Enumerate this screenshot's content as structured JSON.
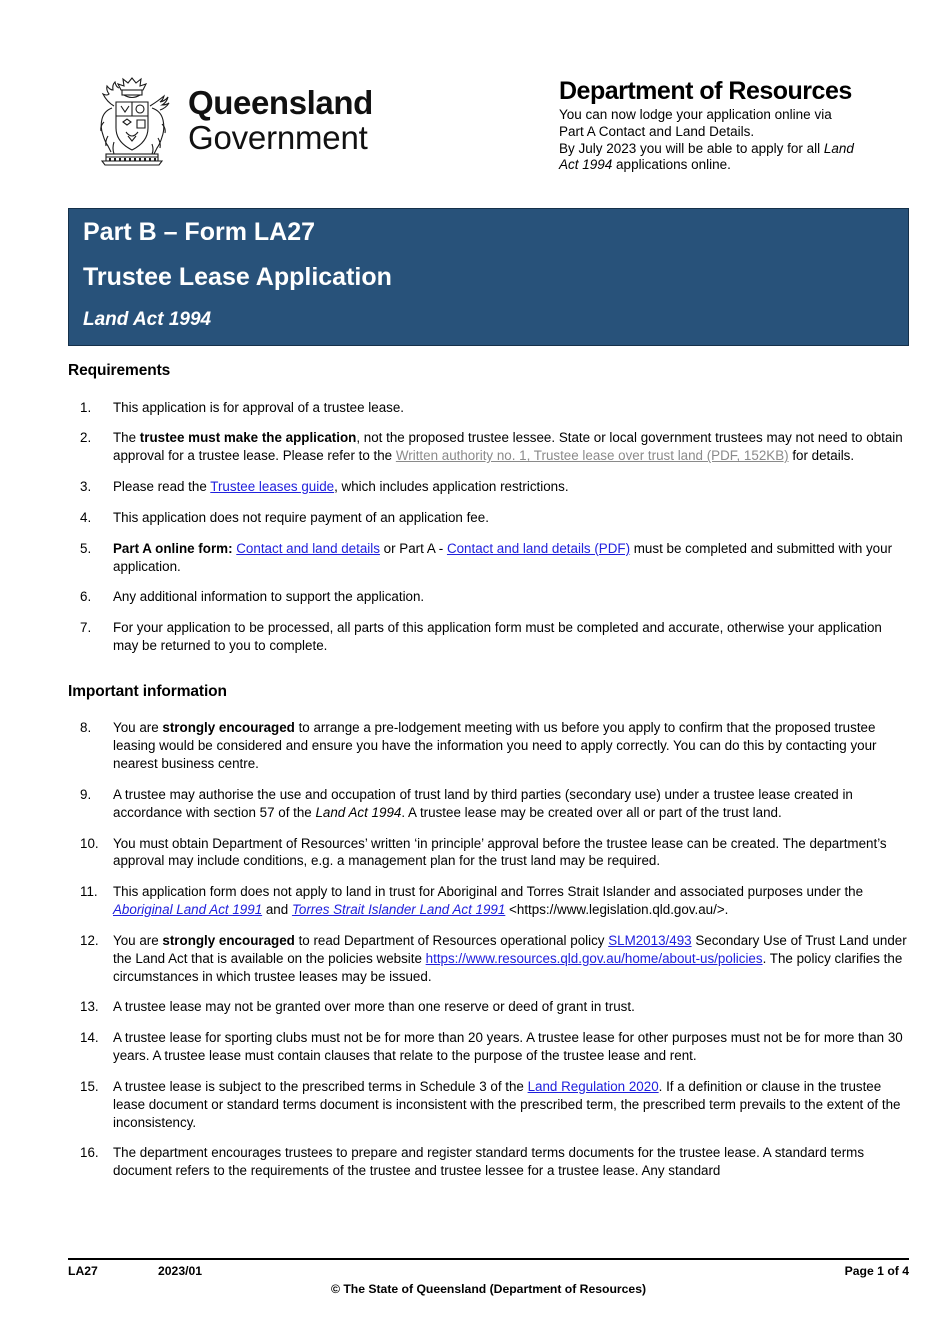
{
  "header": {
    "crest_icon": "queensland-coat-of-arms-icon",
    "wordmark_line1": "Queensland",
    "wordmark_line2": "Government",
    "department_title": "Department of Resources",
    "department_note_line1": "You can now lodge your application online via",
    "department_note_line2": "Part A Contact and Land Details.",
    "department_note_line3_pre": "By July 2023 you will be able to apply for all ",
    "department_note_line3_em": "Land",
    "department_note_line4_em": "Act 1994",
    "department_note_line4_post": " applications online."
  },
  "banner": {
    "line1": "Part B – Form LA27",
    "line2": "Trustee Lease Application",
    "line3": "Land Act 1994",
    "background_color": "#28527a",
    "text_color": "#ffffff"
  },
  "sections": {
    "requirements_heading": "Requirements",
    "important_heading": "Important information"
  },
  "requirements": [
    {
      "num": "1.",
      "parts": [
        {
          "t": "This application is for approval of a trustee lease."
        }
      ]
    },
    {
      "num": "2.",
      "parts": [
        {
          "t": "The "
        },
        {
          "t": "trustee must make the application",
          "b": true
        },
        {
          "t": ", not the proposed trustee lessee. State or local government trustees may not need to obtain approval for a trustee lease. Please refer to the "
        },
        {
          "t": "Written authority no. 1, Trustee lease over trust land (PDF, 152KB)",
          "link": "grey"
        },
        {
          "t": "  for details."
        }
      ]
    },
    {
      "num": "3.",
      "parts": [
        {
          "t": "Please read the "
        },
        {
          "t": "Trustee leases guide",
          "link": "blue"
        },
        {
          "t": ", which includes application restrictions."
        }
      ]
    },
    {
      "num": "4.",
      "parts": [
        {
          "t": "This application does not require payment of an application fee."
        }
      ]
    },
    {
      "num": "5.",
      "parts": [
        {
          "t": "Part A online form:",
          "b": true
        },
        {
          "t": " "
        },
        {
          "t": "Contact and land details",
          "link": "blue"
        },
        {
          "t": " or Part A - "
        },
        {
          "t": "Contact and land details (PDF)",
          "link": "blue"
        },
        {
          "t": " must be completed and submitted with your application."
        }
      ]
    },
    {
      "num": "6.",
      "parts": [
        {
          "t": "Any additional information to support the application."
        }
      ]
    },
    {
      "num": "7.",
      "parts": [
        {
          "t": "For your application to be processed, all parts of this application form must be completed and accurate, otherwise your application may be returned to you to complete."
        }
      ]
    }
  ],
  "important_information": [
    {
      "num": "8.",
      "parts": [
        {
          "t": "You are "
        },
        {
          "t": "strongly encouraged",
          "b": true
        },
        {
          "t": " to arrange a pre-lodgement meeting with us before you apply to confirm that the proposed trustee leasing would be considered and ensure you have the information you need to apply correctly. You can do this by contacting your nearest business centre."
        }
      ]
    },
    {
      "num": "9.",
      "parts": [
        {
          "t": "A trustee may authorise the use and occupation of trust land by third parties (secondary use) under a trustee lease created in accordance with section 57 of the "
        },
        {
          "t": "Land Act 1994",
          "i": true
        },
        {
          "t": ".  A trustee lease may be created over all or part of the trust land."
        }
      ]
    },
    {
      "num": "10.",
      "parts": [
        {
          "t": "You must obtain Department of Resources’ written ‘in principle’ approval before the trustee lease can be created. The department’s approval may include conditions, e.g. a management plan for the trust land may be required."
        }
      ]
    },
    {
      "num": "11.",
      "parts": [
        {
          "t": "This application form does not apply to land in trust for Aboriginal and Torres Strait Islander and associated purposes under the "
        },
        {
          "t": "Aboriginal Land Act 1991",
          "link": "blue",
          "i": true
        },
        {
          "t": " and "
        },
        {
          "t": "Torres Strait Islander Land Act 1991",
          "link": "blue",
          "i": true
        },
        {
          "t": " <https://www.legislation.qld.gov.au/>."
        }
      ]
    },
    {
      "num": "12.",
      "parts": [
        {
          "t": "You are "
        },
        {
          "t": "strongly encouraged",
          "b": true
        },
        {
          "t": " to read Department of Resources operational policy "
        },
        {
          "t": "SLM2013/493",
          "link": "blue"
        },
        {
          "t": " Secondary Use of Trust Land under the Land Act that is available on the policies website "
        },
        {
          "t": "https://www.resources.qld.gov.au/home/about-us/policies",
          "link": "blue"
        },
        {
          "t": ". The policy clarifies the circumstances in which trustee leases may be issued."
        }
      ]
    },
    {
      "num": "13.",
      "parts": [
        {
          "t": "A trustee lease may not be granted over more than one reserve or deed of grant in trust."
        }
      ]
    },
    {
      "num": "14.",
      "parts": [
        {
          "t": "A trustee lease for sporting clubs must not be for more than 20 years. A trustee lease for other purposes must not be for more than 30 years. A trustee lease must contain clauses that relate to the purpose of the trustee lease and rent."
        }
      ]
    },
    {
      "num": "15.",
      "parts": [
        {
          "t": "A trustee lease is subject to the prescribed terms in Schedule 3 of the "
        },
        {
          "t": "Land Regulation 2020",
          "link": "blue"
        },
        {
          "t": ".  If a definition or clause in the trustee lease document or standard terms document is inconsistent with the prescribed term, the prescribed term prevails to the extent of the inconsistency."
        }
      ]
    },
    {
      "num": "16.",
      "parts": [
        {
          "t": "The department encourages trustees to prepare and register standard terms documents for the trustee lease. A standard terms document refers to the requirements of the trustee and trustee lessee for a trustee lease. Any standard"
        }
      ]
    }
  ],
  "footer": {
    "form_code": "LA27",
    "version_date": "2023/01",
    "copyright": "© The State of Queensland (Department of Resources)",
    "page_label": "Page 1 of 4"
  }
}
